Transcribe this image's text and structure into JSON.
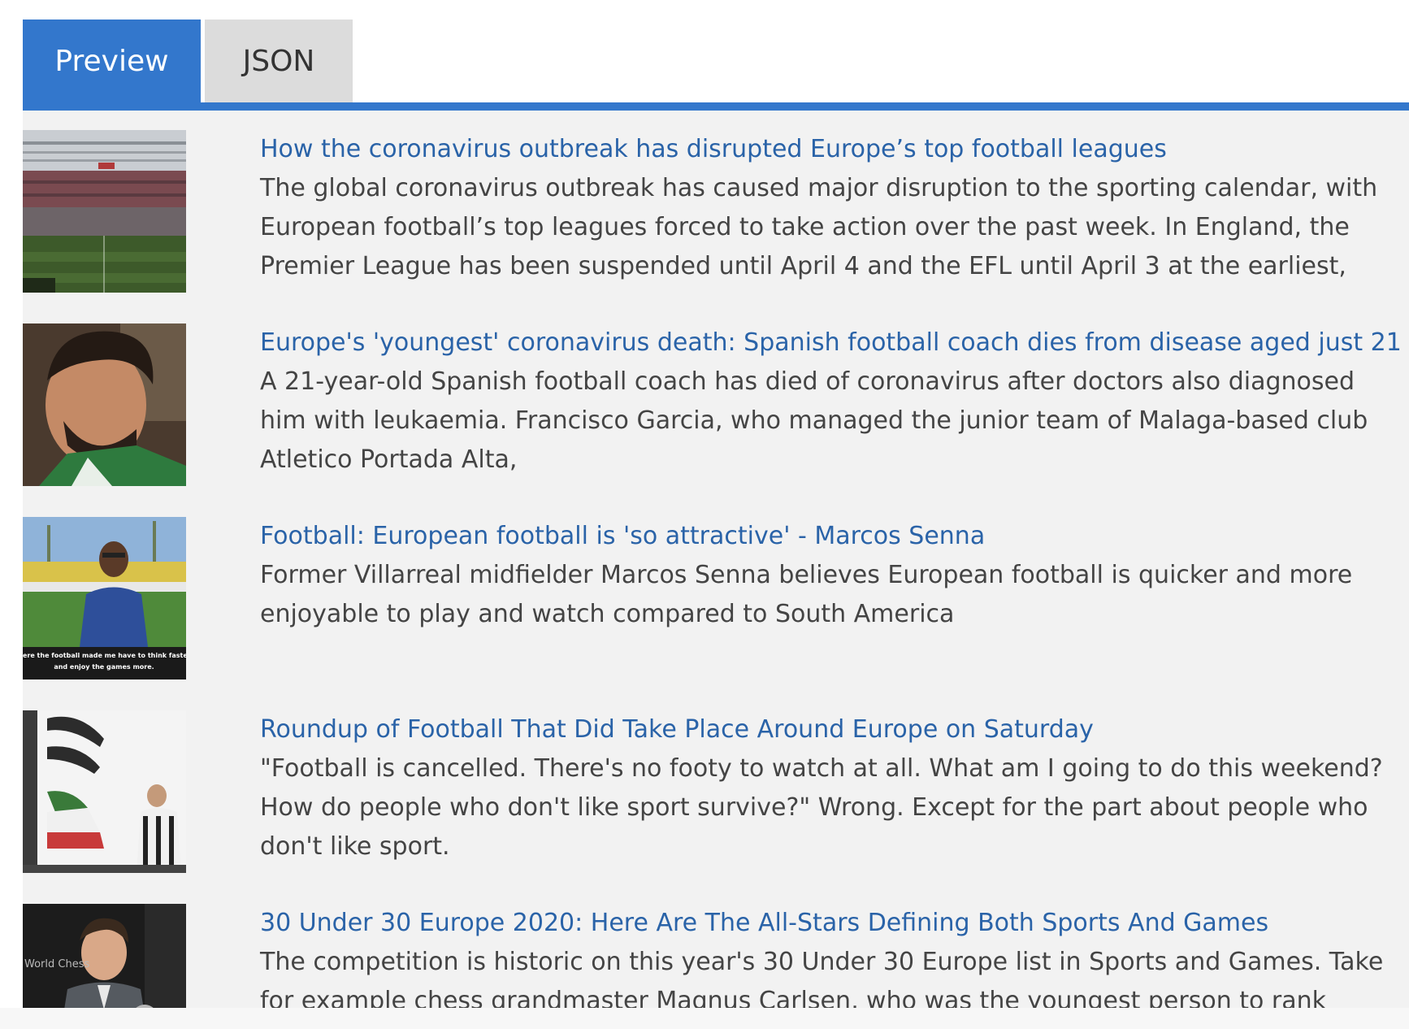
{
  "tabs": {
    "preview": "Preview",
    "json": "JSON"
  },
  "colors": {
    "accent": "#3377cc",
    "link": "#2a63a8",
    "text": "#444444",
    "panel": "#f2f2f2"
  },
  "articles": [
    {
      "title": "How the coronavirus outbreak has disrupted Europe’s top football leagues",
      "description": "The global coronavirus outbreak has caused major disruption to the sporting calendar, with European football’s top leagues forced to take action over the past week. In England, the Premier League has been suspended until April 4 and the EFL until April 3 at the earliest,",
      "thumbnail": "stadium-photo"
    },
    {
      "title": "Europe's 'youngest' coronavirus death: Spanish football coach dies from disease aged just 21",
      "description": "A 21-year-old Spanish football coach has died of coronavirus after doctors also diagnosed him with leukaemia. Francisco Garcia, who managed the junior team of Malaga-based club Atletico Portada Alta,",
      "thumbnail": "portrait-photo"
    },
    {
      "title": "Football: European football is 'so attractive' - Marcos Senna",
      "description": "Former Villarreal midfielder Marcos Senna believes European football is quicker and more enjoyable to play and watch compared to South America",
      "thumbnail": "interview-photo",
      "caption": "Here the football made me have to think faster and enjoy the games more."
    },
    {
      "title": "Roundup of Football That Did Take Place Around Europe on Saturday",
      "description": "\"Football is cancelled. There's no footy to watch at all. What am I going to do this weekend? How do people who don't like sport survive?\" Wrong. Except for the part about people who don't like sport.",
      "thumbnail": "flags-photo"
    },
    {
      "title": "30 Under 30 Europe 2020: Here Are The All-Stars Defining Both Sports And Games",
      "description": "The competition is historic on this year's 30 Under 30 Europe list in Sports and Games. Take for example chess grandmaster Magnus Carlsen, who was the youngest person to rank number one",
      "thumbnail": "chess-photo",
      "caption": "World Chess"
    }
  ]
}
